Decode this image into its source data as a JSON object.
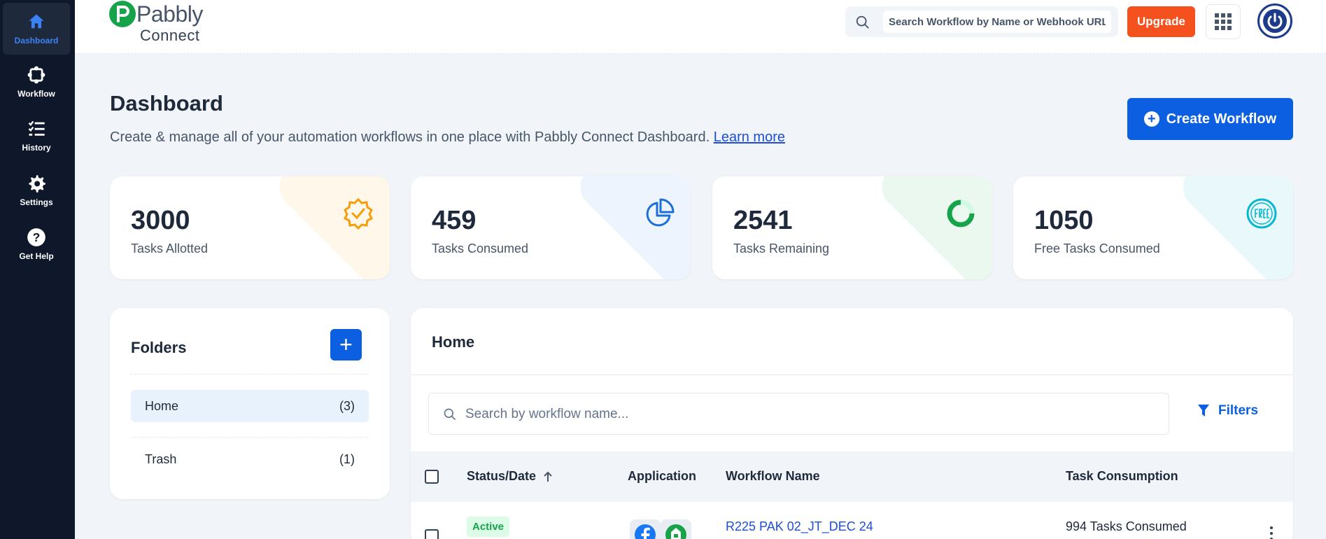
{
  "sidebar": {
    "items": [
      {
        "label": "Dashboard",
        "icon": "home-icon",
        "active": true
      },
      {
        "label": "Workflow",
        "icon": "workflow-icon"
      },
      {
        "label": "History",
        "icon": "history-list-icon"
      },
      {
        "label": "Settings",
        "icon": "gear-icon"
      },
      {
        "label": "Get Help",
        "icon": "help-icon"
      }
    ]
  },
  "header": {
    "logo_name": "Pabbly",
    "logo_sub": "Connect",
    "search_placeholder": "Search Workflow by Name or Webhook URL",
    "upgrade_label": "Upgrade"
  },
  "page": {
    "title": "Dashboard",
    "description": "Create & manage all of your automation workflows in one place with Pabbly Connect Dashboard.",
    "learn_more": "Learn more",
    "create_label": "Create Workflow"
  },
  "stats": [
    {
      "value": "3000",
      "caption": "Tasks Allotted",
      "icon": "badge-check-icon",
      "accent": "#f59e0b"
    },
    {
      "value": "459",
      "caption": "Tasks Consumed",
      "icon": "pie-chart-icon",
      "accent": "#1d6fd8"
    },
    {
      "value": "2541",
      "caption": "Tasks Remaining",
      "icon": "donut-chart-icon",
      "accent": "#16a34a"
    },
    {
      "value": "1050",
      "caption": "Free Tasks Consumed",
      "icon": "free-badge-icon",
      "accent": "#06b6d4"
    }
  ],
  "folders": {
    "title": "Folders",
    "items": [
      {
        "name": "Home",
        "count": "(3)",
        "selected": true
      },
      {
        "name": "Trash",
        "count": "(1)"
      }
    ]
  },
  "workflows": {
    "title": "Home",
    "search_placeholder": "Search by workflow name...",
    "filters_label": "Filters",
    "columns": {
      "status": "Status/Date",
      "application": "Application",
      "name": "Workflow Name",
      "tasks": "Task Consumption"
    },
    "rows": [
      {
        "status": "Active",
        "name": "R225 PAK 02_JT_DEC 24",
        "tasks": "994 Tasks Consumed",
        "apps": [
          "facebook-icon",
          "app-icon"
        ]
      }
    ]
  },
  "colors": {
    "sidebar_bg": "#0f172a",
    "primary": "#0b5fe0",
    "upgrade": "#f4511e",
    "page_bg": "#f1f5f9"
  }
}
